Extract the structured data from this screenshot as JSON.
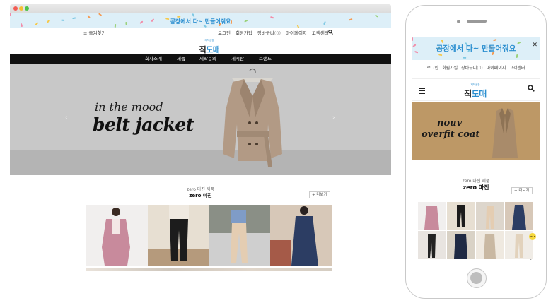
{
  "colors": {
    "promo_bg": "#ddeff8",
    "promo_text": "#2c8fd0",
    "nav_bg": "#111111",
    "hero_bg": "#c8c8c8",
    "mobile_banner_bg": "#bd9866"
  },
  "desktop": {
    "promo": {
      "text": "공장에서 다~ 만들어줘요"
    },
    "utility": {
      "bookmark_icon": "menu-icon",
      "bookmark_label": "즐겨찾기",
      "links": [
        "로그인",
        "회원가입",
        "장바구니",
        "마이페이지",
        "고객센터"
      ],
      "cart_count": "(0)",
      "search_icon": "search-icon"
    },
    "logo": {
      "small": "제작공장",
      "main_a": "직",
      "main_b": "도매"
    },
    "nav": [
      "회사소개",
      "제품",
      "제작문의",
      "게시판",
      "브랜드"
    ],
    "hero": {
      "line1": "in the mood",
      "line2": "belt jacket",
      "prev": "‹",
      "next": "›"
    },
    "section": {
      "subtitle": "zero 마진 제품",
      "title": "zero 마진",
      "more": "+ 더보기"
    }
  },
  "mobile": {
    "promo": {
      "text": "공장에서 다~ 만들어줘요",
      "close": "✕"
    },
    "utility": {
      "links": [
        "로그인",
        "회원가입",
        "장바구니",
        "마이페이지",
        "고객센터"
      ],
      "cart_count": "(0)"
    },
    "logo": {
      "small": "제작공장",
      "main_a": "직",
      "main_b": "도매"
    },
    "banner": {
      "line1": "nouv",
      "line2": "overfit coat"
    },
    "section": {
      "subtitle": "zero 마진 제품",
      "title": "zero 마진",
      "more": "+ 더보기"
    },
    "chat_icon": "talk",
    "chat_label": "TALK"
  }
}
